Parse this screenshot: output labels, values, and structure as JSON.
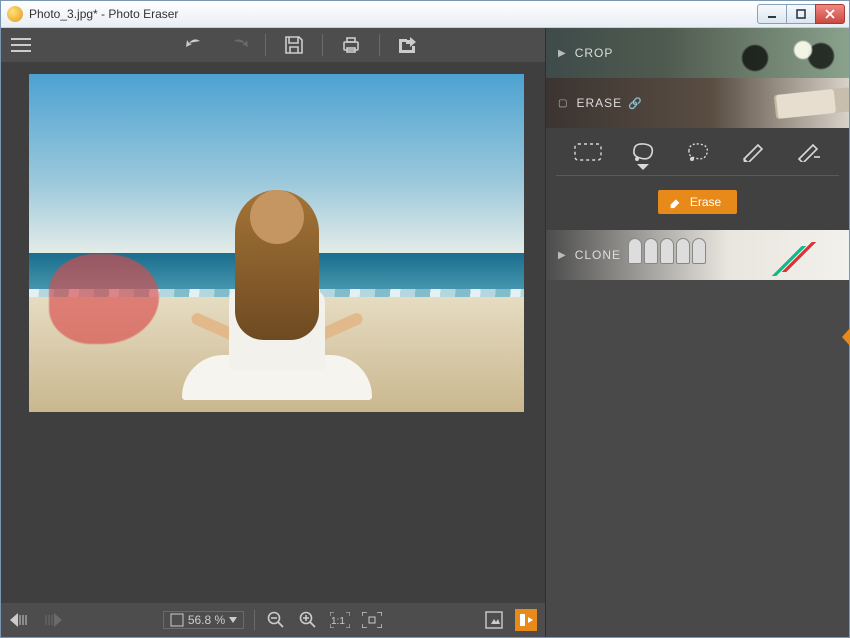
{
  "window": {
    "title": "Photo_3.jpg* - Photo Eraser"
  },
  "panels": {
    "crop": {
      "label": "CROP"
    },
    "erase": {
      "label": "ERASE",
      "button_label": "Erase"
    },
    "clone": {
      "label": "CLONE"
    }
  },
  "status": {
    "zoom_percent": "56.8 %"
  }
}
